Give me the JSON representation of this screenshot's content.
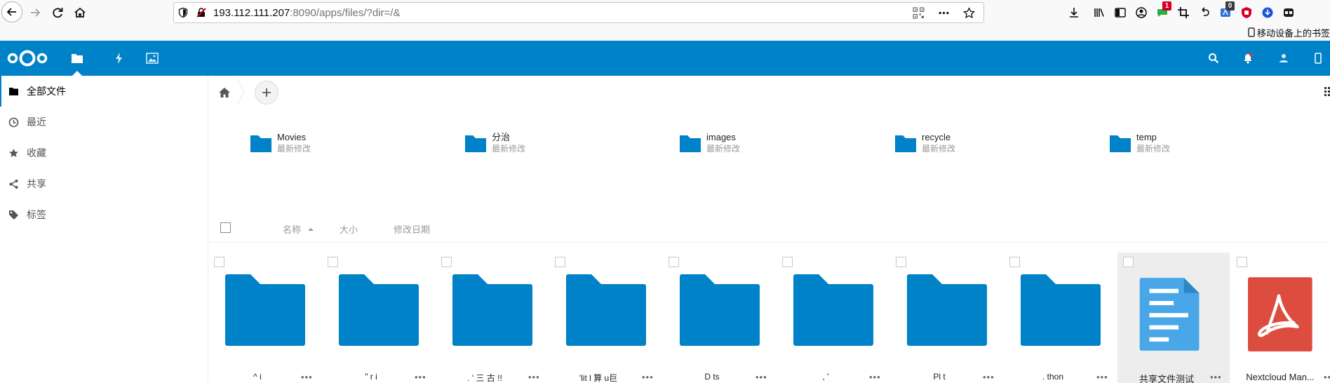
{
  "browser": {
    "url_host": "193.112.111.207",
    "url_rest": ":8090/apps/files/?dir=/&",
    "badge_messages": "1",
    "badge_dark": "0",
    "bookmark_label": "移动设备上的书签"
  },
  "header": {
    "accent": "#0082c9",
    "apps": [
      "files-icon",
      "activity-icon",
      "gallery-icon"
    ]
  },
  "sidebar": {
    "items": [
      {
        "label": "全部文件",
        "icon": "folder-icon"
      },
      {
        "label": "最近",
        "icon": "clock-icon"
      },
      {
        "label": "收藏",
        "icon": "star-icon"
      },
      {
        "label": "共享",
        "icon": "share-icon"
      },
      {
        "label": "标签",
        "icon": "tag-icon"
      }
    ]
  },
  "recent": [
    {
      "name": "Movies",
      "sub": "最新修改"
    },
    {
      "name": "分治",
      "sub": "最新修改"
    },
    {
      "name": "images",
      "sub": "最新修改"
    },
    {
      "name": "recycle",
      "sub": "最新修改"
    },
    {
      "name": "temp",
      "sub": "最新修改"
    }
  ],
  "list_header": {
    "name": "名称",
    "size": "大小",
    "modified": "修改日期"
  },
  "tiles": [
    {
      "name": "^ i",
      "type": "folder"
    },
    {
      "name": "\"    r  i",
      "type": "folder"
    },
    {
      "name": "  .  ' 三  古   !!",
      "type": "folder"
    },
    {
      "name": "'lit    l 算  u巨    ",
      "type": "folder"
    },
    {
      "name": "D       ts",
      "type": "folder"
    },
    {
      "name": "  , '   ",
      "type": "folder"
    },
    {
      "name": "Pl    t",
      "type": "folder"
    },
    {
      "name": "  .  thon",
      "type": "folder"
    },
    {
      "name": "共享文件测试",
      "type": "document"
    },
    {
      "name": "Nextcloud Man...",
      "type": "pdf"
    }
  ],
  "more_label": "•••"
}
